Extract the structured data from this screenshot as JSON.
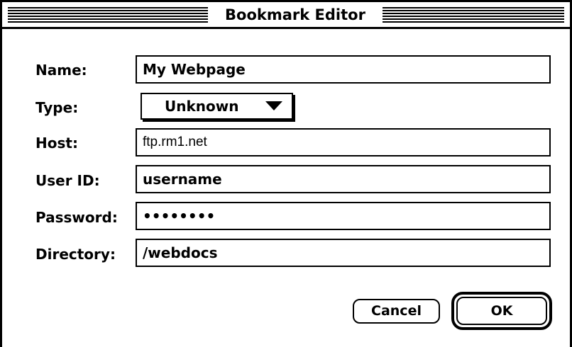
{
  "window": {
    "title": "Bookmark Editor"
  },
  "form": {
    "name_label": "Name:",
    "name_value": "My Webpage",
    "type_label": "Type:",
    "type_value": "Unknown",
    "host_label": "Host:",
    "host_value": "ftp.rm1.net",
    "userid_label": "User ID:",
    "userid_value": "username",
    "password_label": "Password:",
    "password_value": "••••••••",
    "directory_label": "Directory:",
    "directory_value": "/webdocs"
  },
  "buttons": {
    "cancel_label": "Cancel",
    "ok_label": "OK"
  },
  "icons": {
    "popup_arrow": "triangle-down-icon"
  }
}
